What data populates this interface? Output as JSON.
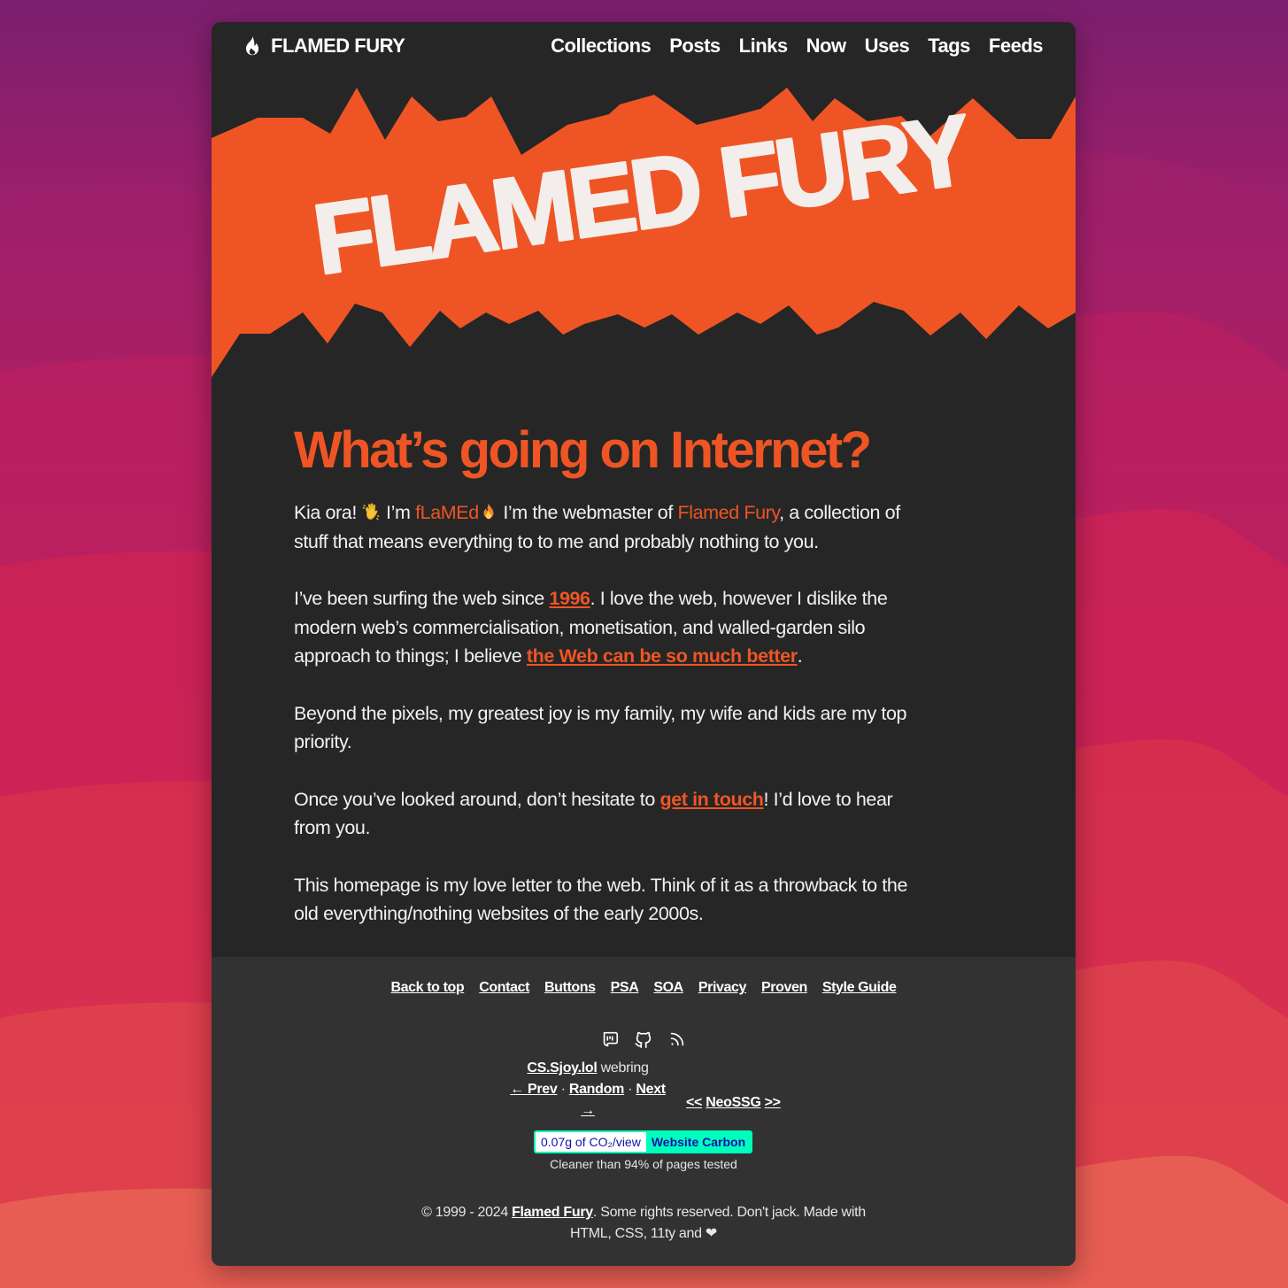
{
  "brand": {
    "name": "FLAMED FURY",
    "icon": "flame-icon"
  },
  "nav": [
    {
      "label": "Collections"
    },
    {
      "label": "Posts"
    },
    {
      "label": "Links"
    },
    {
      "label": "Now"
    },
    {
      "label": "Uses"
    },
    {
      "label": "Tags"
    },
    {
      "label": "Feeds"
    }
  ],
  "banner": {
    "title": "FLAMED FURY"
  },
  "main": {
    "heading": "What’s going on Internet?",
    "p1": {
      "a": "Kia ora! ",
      "b": " I’m ",
      "c": "fLaMEd",
      "d": " I’m the webmaster of ",
      "e": "Flamed Fury",
      "f": ", a collection of stuff that means everything to to me and probably nothing to you."
    },
    "p2": {
      "a": "I’ve been surfing the web since ",
      "link1": "1996",
      "b": ". I love the web, however I dislike the modern web’s commercialisation, monetisation, and walled-garden silo approach to things; I believe ",
      "link2": "the Web can be so much better",
      "c": "."
    },
    "p3": "Beyond the pixels, my greatest joy is my family, my wife and kids are my top priority.",
    "p4": {
      "a": "Once you’ve looked around, don’t hesitate to ",
      "link": "get in touch",
      "b": "! I’d love to hear from you."
    },
    "p5": "This homepage is my love letter to the web. Think of it as a throwback to the old everything/nothing websites of the early 2000s."
  },
  "footer": {
    "links": [
      "Back to top",
      "Contact",
      "Buttons",
      "PSA",
      "SOA",
      "Privacy",
      "Proven",
      "Style Guide"
    ],
    "social_icons": [
      "mastodon-icon",
      "github-icon",
      "rss-icon"
    ],
    "webring": {
      "site": "CS.Sjoy.lol",
      "word": " webring",
      "prev": "← Prev",
      "random": "Random",
      "next": "Next →",
      "sep": " · "
    },
    "neossg": {
      "left": "<<",
      "name": "NeoSSG",
      "right": ">>"
    },
    "carbon": {
      "amount": "0.07g of CO₂/view",
      "label": "Website Carbon",
      "cleaner": "Cleaner than 94% of pages tested"
    },
    "copyright": {
      "a": "© 1999 - 2024 ",
      "link": "Flamed Fury",
      "b": ". Some rights reserved. Don't jack. Made with HTML, CSS, 11ty and ❤"
    }
  },
  "colors": {
    "accent": "#ef5524",
    "card": "#262626",
    "footer": "#323232",
    "carbon_green": "#00ffbc"
  }
}
